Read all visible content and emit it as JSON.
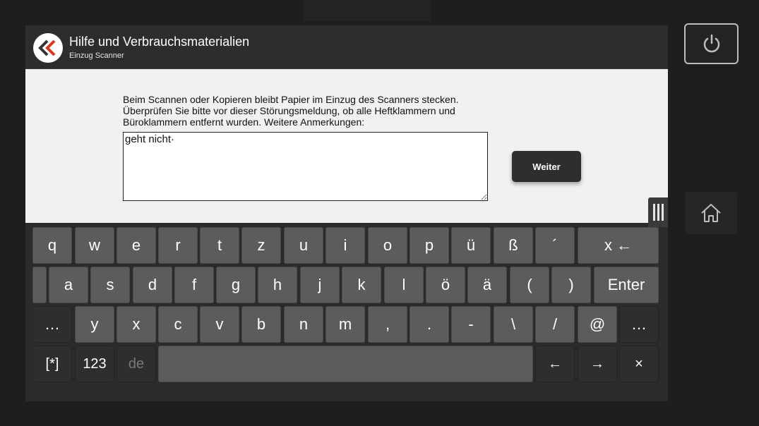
{
  "header": {
    "title": "Hilfe und Verbrauchsmaterialien",
    "subtitle": "Einzug Scanner"
  },
  "content": {
    "message_line1": "Beim Scannen oder Kopieren bleibt Papier im Einzug des Scanners stecken.",
    "message_line2": "Überprüfen Sie bitte vor dieser Störungsmeldung, ob alle Heftklammern und",
    "message_line3": "Büroklammern entfernt wurden. Weitere Anmerkungen:",
    "notes_value": "geht nicht·",
    "next_label": "Weiter"
  },
  "keyboard": {
    "row1": [
      "q",
      "w",
      "e",
      "r",
      "t",
      "z",
      "u",
      "i",
      "o",
      "p",
      "ü",
      "ß",
      "´",
      "x ←"
    ],
    "row2": [
      "a",
      "s",
      "d",
      "f",
      "g",
      "h",
      "j",
      "k",
      "l",
      "ö",
      "ä",
      "(",
      ")",
      "Enter"
    ],
    "row3": [
      "…",
      "y",
      "x",
      "c",
      "v",
      "b",
      "n",
      "m",
      ",",
      ".",
      "-",
      "\\",
      "/",
      "@",
      "…"
    ],
    "row4": [
      "[*]",
      "123",
      "de",
      "",
      "←",
      "→",
      "×"
    ]
  },
  "colors": {
    "accent_red": "#d9381e",
    "accent_dark": "#333333"
  }
}
